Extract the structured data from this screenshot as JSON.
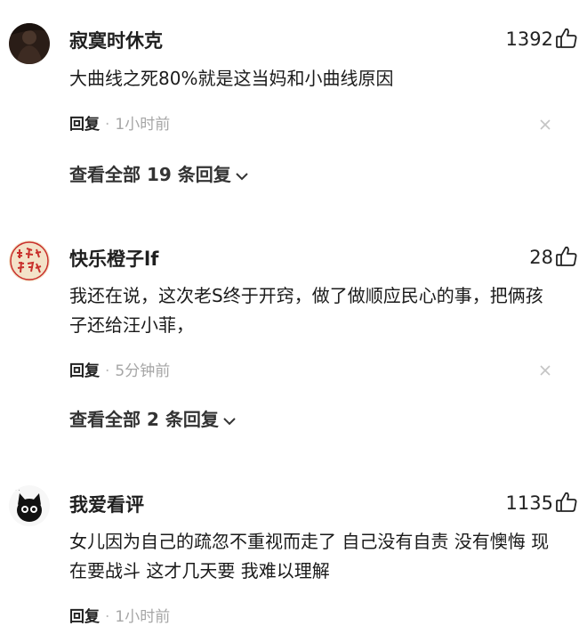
{
  "comments": [
    {
      "username": "寂寞时休克",
      "likes": "1392",
      "content": "大曲线之死80%就是这当妈和小曲线原因",
      "reply_label": "回复",
      "time": "1小时前",
      "view_replies": "查看全部 19 条回复",
      "avatar_icon": "dark-figure-avatar"
    },
    {
      "username": "快乐橙子lf",
      "likes": "28",
      "content": "我还在说，这次老S终于开窍，做了做顺应民心的事，把俩孩子还给汪小菲，",
      "reply_label": "回复",
      "time": "5分钟前",
      "view_replies": "查看全部 2 条回复",
      "avatar_icon": "red-calligraphy-avatar"
    },
    {
      "username": "我爱看评",
      "likes": "1135",
      "content": "女儿因为自己的疏忽不重视而走了 自己没有自责 没有懊悔 现在要战斗 这才几天要 我难以理解",
      "reply_label": "回复",
      "time": "1小时前",
      "avatar_icon": "black-cat-avatar"
    }
  ]
}
